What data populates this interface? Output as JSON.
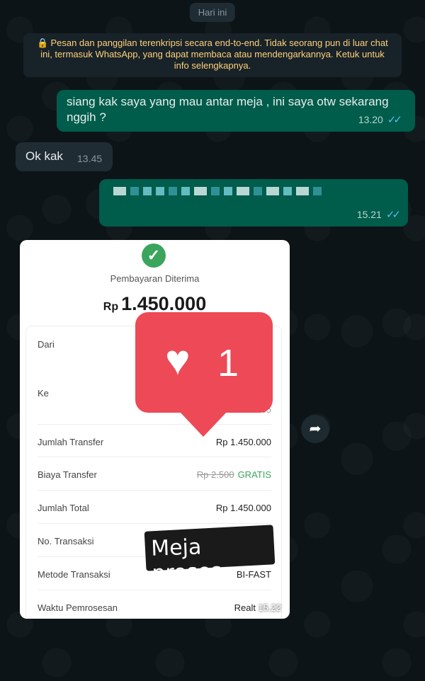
{
  "date_chip": "Hari ini",
  "notice": {
    "lock_icon": "lock-icon",
    "text": "Pesan dan panggilan terenkripsi secara end-to-end. Tidak seorang pun di luar chat ini, termasuk WhatsApp, yang dapat membaca atau mendengarkannya. Ketuk untuk info selengkapnya."
  },
  "messages": [
    {
      "direction": "outgoing",
      "text": "siang kak saya yang mau antar meja , ini saya otw sekarang nggih ?",
      "time": "13.20",
      "status": "read"
    },
    {
      "direction": "incoming",
      "text": "Ok kak",
      "time": "13.45"
    },
    {
      "direction": "outgoing",
      "text": "",
      "time": "15.21",
      "status": "read"
    }
  ],
  "receipt": {
    "status_title": "Pembayaran Diterima",
    "currency": "Rp",
    "amount": "1.450.000",
    "rows": [
      {
        "label": "Dari",
        "value": ""
      },
      {
        "label": "Ke",
        "value": "...35"
      },
      {
        "label": "Jumlah Transfer",
        "value": "Rp 1.450.000"
      },
      {
        "label": "Biaya Transfer",
        "strike": "Rp 2.500",
        "value": "GRATIS"
      },
      {
        "label": "Jumlah Total",
        "value": "Rp 1.450.000"
      },
      {
        "label": "No. Transaksi",
        "value": ""
      },
      {
        "label": "Metode Transaksi",
        "value": "BI-FAST"
      },
      {
        "label": "Waktu Pemrosesan",
        "value": "Realt"
      }
    ],
    "time": "15.22"
  },
  "like_badge": {
    "count": "1"
  },
  "sticker_text": "Meja proses",
  "colors": {
    "outgoing": "#005c4b",
    "incoming": "#202c33",
    "like": "#ed4956",
    "check": "#3ba55d"
  }
}
